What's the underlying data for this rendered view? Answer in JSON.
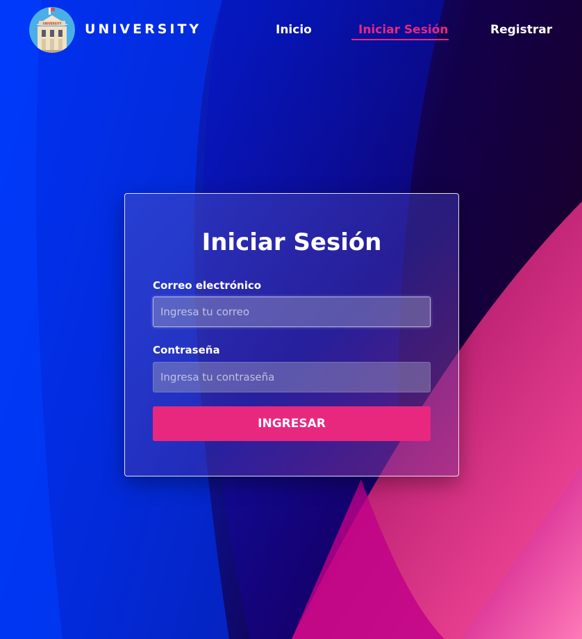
{
  "header": {
    "brand": "UNIVERSITY",
    "logo_icon": "university-building-icon",
    "logo_sign": "UNIVERSITY",
    "nav": [
      {
        "label": "Inicio",
        "active": false
      },
      {
        "label": "Iniciar Sesión",
        "active": true
      },
      {
        "label": "Registrar",
        "active": false
      }
    ]
  },
  "login_form": {
    "title": "Iniciar Sesión",
    "email_label": "Correo electrónico",
    "email_placeholder": "Ingresa tu correo",
    "email_value": "",
    "password_label": "Contraseña",
    "password_placeholder": "Ingresa tu contraseña",
    "password_value": "",
    "submit_label": "INGRESAR"
  },
  "colors": {
    "accent": "#e8277f",
    "background_blue": "#0033ff",
    "background_dark": "#160033",
    "background_pink": "#ff4fa0"
  }
}
